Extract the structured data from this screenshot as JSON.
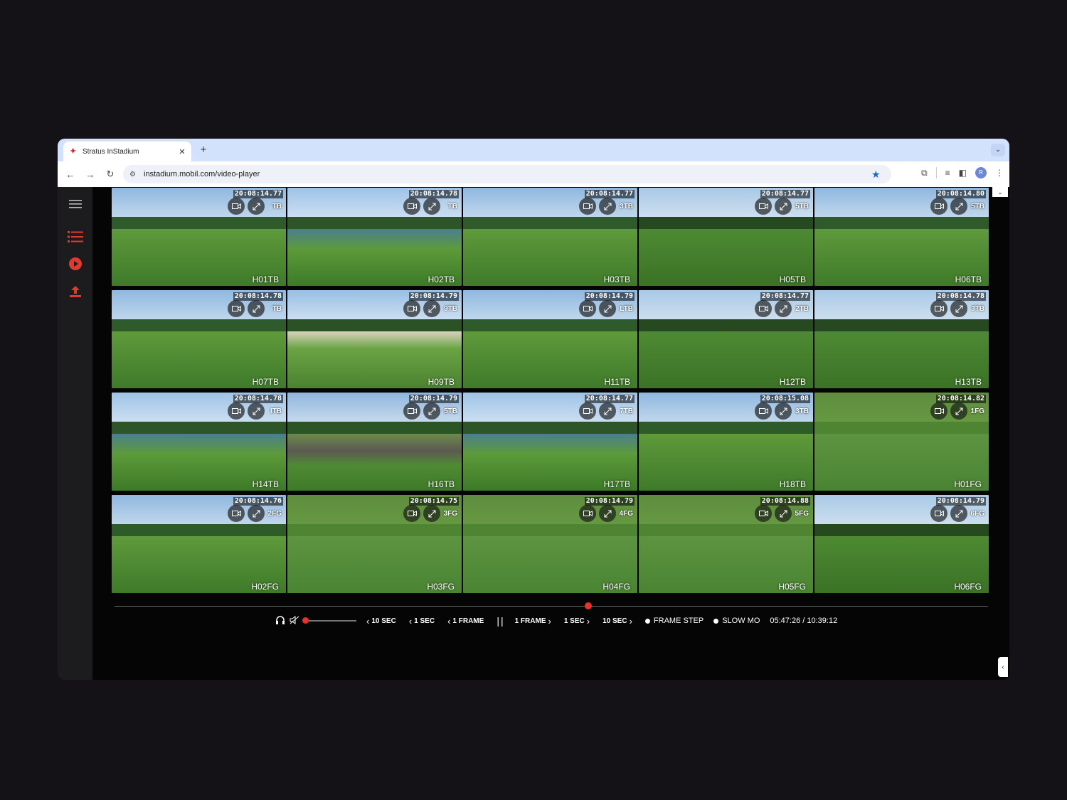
{
  "browser": {
    "tab_title": "Stratus InStadium",
    "new_tab_glyph": "+",
    "url": "instadium.mobil.com/video-player"
  },
  "tiles": [
    {
      "label": "H01TB",
      "timestamp": "20:08:14.77",
      "code_suffix": "TB",
      "scene": "fairway"
    },
    {
      "label": "H02TB",
      "timestamp": "20:08:14.78",
      "code_suffix": "TB",
      "scene": "water"
    },
    {
      "label": "H03TB",
      "timestamp": "20:08:14.77",
      "code_suffix": "3TB",
      "scene": "fairway"
    },
    {
      "label": "H05TB",
      "timestamp": "20:08:14.77",
      "code_suffix": "5TB",
      "scene": "trees"
    },
    {
      "label": "H06TB",
      "timestamp": "20:08:14.80",
      "code_suffix": "5TB",
      "scene": "fairway"
    },
    {
      "label": "H07TB",
      "timestamp": "20:08:14.78",
      "code_suffix": "TB",
      "scene": "fairway"
    },
    {
      "label": "H09TB",
      "timestamp": "20:08:14.79",
      "code_suffix": "9TB",
      "scene": "bunker"
    },
    {
      "label": "H11TB",
      "timestamp": "20:08:14.79",
      "code_suffix": "LTB",
      "scene": "fairway"
    },
    {
      "label": "H12TB",
      "timestamp": "20:08:14.77",
      "code_suffix": "2TB",
      "scene": "trees"
    },
    {
      "label": "H13TB",
      "timestamp": "20:08:14.78",
      "code_suffix": "3TB",
      "scene": "trees"
    },
    {
      "label": "H14TB",
      "timestamp": "20:08:14.78",
      "code_suffix": "ITB",
      "scene": "water"
    },
    {
      "label": "H16TB",
      "timestamp": "20:08:14.79",
      "code_suffix": "5TB",
      "scene": "rocks"
    },
    {
      "label": "H17TB",
      "timestamp": "20:08:14.77",
      "code_suffix": "7TB",
      "scene": "water"
    },
    {
      "label": "H18TB",
      "timestamp": "20:08:15.08",
      "code_suffix": "3TB",
      "scene": "fairway"
    },
    {
      "label": "H01FG",
      "timestamp": "20:08:14.82",
      "code_suffix": "1FG",
      "scene": "green"
    },
    {
      "label": "H02FG",
      "timestamp": "20:08:14.76",
      "code_suffix": "2FG",
      "scene": "fairway"
    },
    {
      "label": "H03FG",
      "timestamp": "20:08:14.75",
      "code_suffix": "3FG",
      "scene": "green"
    },
    {
      "label": "H04FG",
      "timestamp": "20:08:14.79",
      "code_suffix": "4FG",
      "scene": "green"
    },
    {
      "label": "H05FG",
      "timestamp": "20:08:14.88",
      "code_suffix": "5FG",
      "scene": "green"
    },
    {
      "label": "H06FG",
      "timestamp": "20:08:14.79",
      "code_suffix": "6FG",
      "scene": "trees"
    }
  ],
  "controls": {
    "back_10": "10 SEC",
    "back_1": "1 SEC",
    "back_frame": "1 FRAME",
    "pause": "||",
    "fwd_frame": "1 FRAME",
    "fwd_1": "1 SEC",
    "fwd_10": "10 SEC",
    "frame_step": "FRAME STEP",
    "slow_mo": "SLOW MO",
    "time": "05:47:26 / 10:39:12"
  },
  "colors": {
    "accent": "#e8322c",
    "sidebar_icon": "#e03a2f"
  }
}
